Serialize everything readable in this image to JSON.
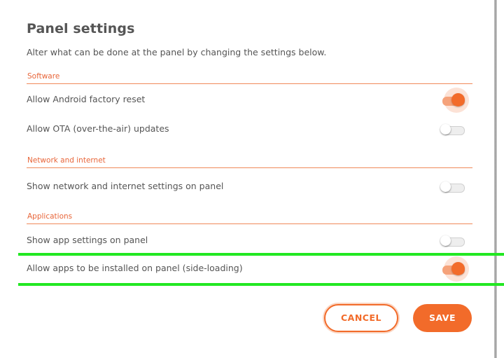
{
  "dialog": {
    "title": "Panel settings",
    "subtitle": "Alter what can be done at the panel by changing the settings below."
  },
  "sections": [
    {
      "heading": "Software",
      "settings": [
        {
          "label": "Allow Android factory reset",
          "enabled": true
        },
        {
          "label": "Allow OTA (over-the-air) updates",
          "enabled": false
        }
      ]
    },
    {
      "heading": "Network and internet",
      "settings": [
        {
          "label": "Show network and internet settings on panel",
          "enabled": false
        }
      ]
    },
    {
      "heading": "Applications",
      "settings": [
        {
          "label": "Show app settings on panel",
          "enabled": false
        },
        {
          "label": "Allow apps to be installed on panel (side-loading)",
          "enabled": true
        }
      ]
    }
  ],
  "actions": {
    "cancel_label": "CANCEL",
    "save_label": "SAVE"
  },
  "colors": {
    "accent": "#f26b2a",
    "highlight": "#22e822",
    "text": "#555555"
  }
}
